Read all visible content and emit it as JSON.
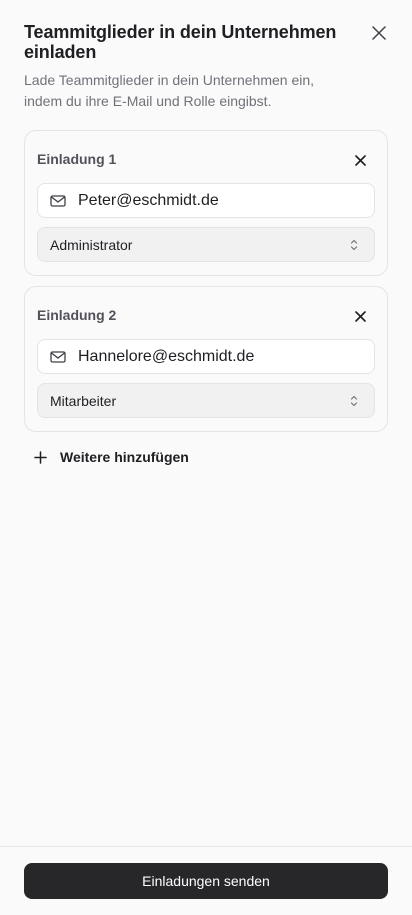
{
  "dialog": {
    "title": "Teammitglieder in dein Unternehmen einladen",
    "subtitle": "Lade Teammitglieder in dein Unternehmen ein, indem du ihre E-Mail und Rolle eingibst.",
    "close_icon": "close-icon"
  },
  "invitations": [
    {
      "title": "Einladung 1",
      "email": "Peter@eschmidt.de",
      "role": "Administrator"
    },
    {
      "title": "Einladung 2",
      "email": "Hannelore@eschmidt.de",
      "role": "Mitarbeiter"
    }
  ],
  "add_more": {
    "label": "Weitere hinzufügen",
    "icon": "plus-icon"
  },
  "footer": {
    "send_label": "Einladungen senden"
  },
  "colors": {
    "background": "#fafafa",
    "primary_button": "#27272a",
    "border": "#e4e4e7",
    "muted_text": "#71717a"
  }
}
